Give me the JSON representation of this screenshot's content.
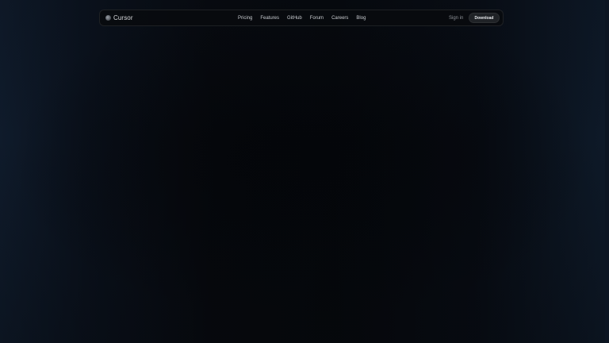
{
  "nav": {
    "brand": "Cursor",
    "logo_icon": "cursor-logo-icon",
    "links": [
      {
        "label": "Pricing"
      },
      {
        "label": "Features"
      },
      {
        "label": "GitHub"
      },
      {
        "label": "Forum"
      },
      {
        "label": "Careers"
      },
      {
        "label": "Blog"
      }
    ],
    "sign_in": "Sign in",
    "download": "Download"
  },
  "colors": {
    "background": "#05070a",
    "edge_glow": "#0f1b2b",
    "text": "#c9ccd1",
    "button_bg": "#1f2226"
  }
}
